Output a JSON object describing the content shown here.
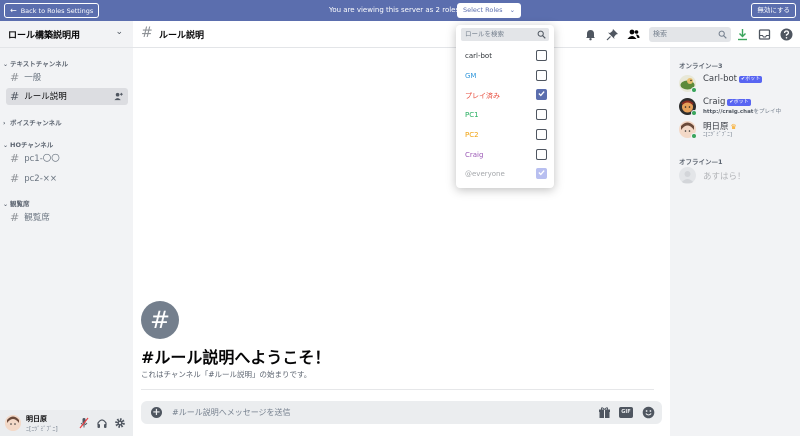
{
  "banner": {
    "back_label": "Back to Roles Settings",
    "message": "You are viewing this server as 2 roles.",
    "select_roles_label": "Select Roles",
    "disable_label": "無効にする"
  },
  "server": {
    "name": "ロール構築説明用"
  },
  "sidebar": {
    "categories": [
      {
        "label": "テキストチャンネル",
        "channels": [
          "一般",
          "ルール説明"
        ]
      },
      {
        "label": "ボイスチャンネル",
        "channels": []
      },
      {
        "label": "HOチャンネル",
        "channels": [
          "pc1-〇〇",
          "pc2-××"
        ]
      },
      {
        "label": "観覧席",
        "channels": [
          "観覧席"
        ]
      }
    ],
    "active_channel": "ルール説明"
  },
  "user_panel": {
    "name": "明日原",
    "status": "ﾆ[ﾆﾂﾞﾐﾞﾌﾞﾆ]"
  },
  "chat_header": {
    "title": "ルール説明",
    "search_placeholder": "検索"
  },
  "welcome": {
    "icon_glyph": "#",
    "title": "#ルール説明へようこそ！",
    "subtitle": "これはチャンネル「#ルール説明」の始まりです。"
  },
  "message_input": {
    "placeholder": "#ルール説明へメッセージを送信",
    "gif_label": "GIF"
  },
  "role_picker": {
    "search_placeholder": "ロールを検索",
    "roles": [
      {
        "name": "carl-bot",
        "color": "#2e3338",
        "checked": false
      },
      {
        "name": "GM",
        "color": "#3498db",
        "checked": false
      },
      {
        "name": "プレイ済み",
        "color": "#e74c3c",
        "checked": true
      },
      {
        "name": "PC1",
        "color": "#27ae60",
        "checked": false
      },
      {
        "name": "PC2",
        "color": "#f1a20e",
        "checked": false
      },
      {
        "name": "Craig",
        "color": "#9b59b6",
        "checked": false
      },
      {
        "name": "@everyone",
        "color": "#a3a6aa",
        "checked": true,
        "disabled": true
      }
    ]
  },
  "members": {
    "online_label": "オンライン—3",
    "offline_label": "オフライン—1",
    "online": [
      {
        "name": "Carl-bot",
        "bot_tag": "✔ボット",
        "sub": ""
      },
      {
        "name": "Craig",
        "bot_tag": "✔ボット",
        "sub_bold": "http://craig.chat",
        "sub": "をプレイ中"
      },
      {
        "name": "明日原",
        "crown": "♛",
        "sub": "ﾆ[ﾆﾂﾞﾐﾞﾌﾞﾆ]"
      }
    ],
    "offline": [
      {
        "name": "あすはら！"
      }
    ]
  },
  "colors": {
    "banner": "#5b6eae",
    "accent": "#5865f2",
    "online": "#3ba55d",
    "sidebar_bg": "#f2f3f5"
  }
}
